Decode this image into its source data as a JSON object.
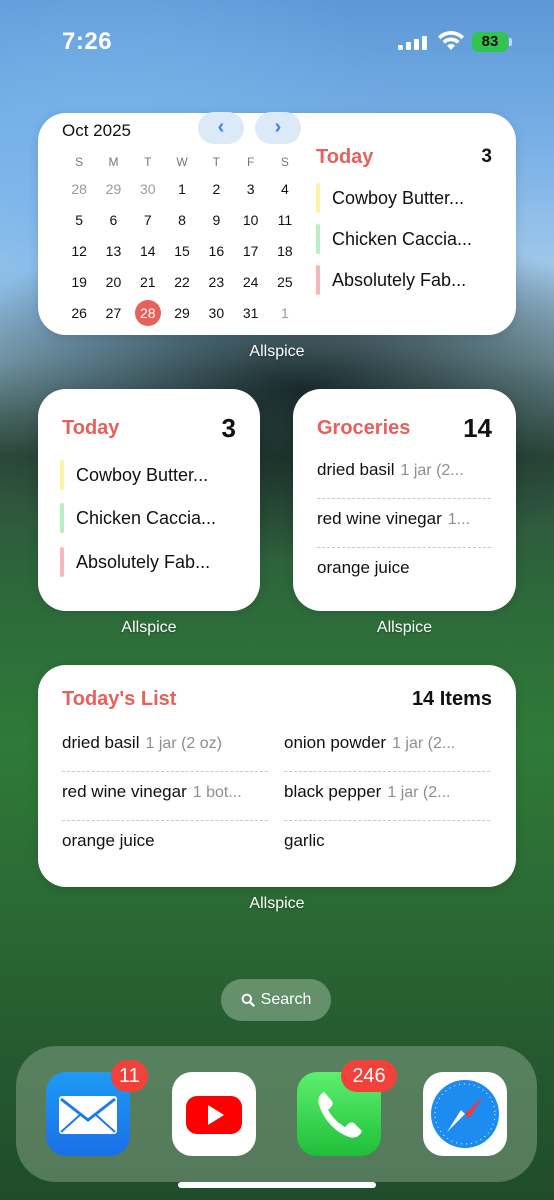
{
  "status_bar": {
    "time": "7:26",
    "battery": "83"
  },
  "calendar_widget": {
    "month": "Oct 2025",
    "weekdays": [
      "S",
      "M",
      "T",
      "W",
      "T",
      "F",
      "S"
    ],
    "weeks": [
      [
        "28",
        "29",
        "30",
        "1",
        "2",
        "3",
        "4"
      ],
      [
        "5",
        "6",
        "7",
        "8",
        "9",
        "10",
        "11"
      ],
      [
        "12",
        "13",
        "14",
        "15",
        "16",
        "17",
        "18"
      ],
      [
        "19",
        "20",
        "21",
        "22",
        "23",
        "24",
        "25"
      ],
      [
        "26",
        "27",
        "28",
        "29",
        "30",
        "31",
        "1"
      ]
    ],
    "selected_day": "28",
    "section_title": "Today",
    "count": "3",
    "recipes": [
      {
        "name": "Cowboy Butter...",
        "color": "#fbf3a6"
      },
      {
        "name": "Chicken Caccia...",
        "color": "#b9edc4"
      },
      {
        "name": "Absolutely Fab...",
        "color": "#f6b8bd"
      }
    ],
    "app_label": "Allspice"
  },
  "today_widget": {
    "title": "Today",
    "count": "3",
    "recipes": [
      {
        "name": "Cowboy Butter...",
        "color": "#fbf3a6"
      },
      {
        "name": "Chicken Caccia...",
        "color": "#b9edc4"
      },
      {
        "name": "Absolutely Fab...",
        "color": "#f6b8bd"
      }
    ],
    "app_label": "Allspice"
  },
  "groceries_widget": {
    "title": "Groceries",
    "count": "14",
    "items": [
      {
        "name": "dried basil",
        "qty": "1 jar (2..."
      },
      {
        "name": "red wine vinegar",
        "qty": "1..."
      },
      {
        "name": "orange juice",
        "qty": ""
      }
    ],
    "app_label": "Allspice"
  },
  "list_widget": {
    "title": "Today's List",
    "count": "14 Items",
    "left_items": [
      {
        "name": "dried basil",
        "qty": "1 jar (2 oz)"
      },
      {
        "name": "red wine vinegar",
        "qty": "1 bot..."
      },
      {
        "name": "orange juice",
        "qty": ""
      }
    ],
    "right_items": [
      {
        "name": "onion powder",
        "qty": "1 jar (2..."
      },
      {
        "name": "black pepper",
        "qty": "1 jar (2..."
      },
      {
        "name": "garlic",
        "qty": ""
      }
    ],
    "app_label": "Allspice"
  },
  "search": {
    "label": "Search"
  },
  "dock": {
    "apps": [
      {
        "name": "mail",
        "badge": "11"
      },
      {
        "name": "youtube",
        "badge": ""
      },
      {
        "name": "phone",
        "badge": "246"
      },
      {
        "name": "safari",
        "badge": ""
      }
    ]
  },
  "colors": {
    "accent": "#e8605c",
    "today_circle": "#e8605c",
    "nav": "#3b82f6"
  }
}
